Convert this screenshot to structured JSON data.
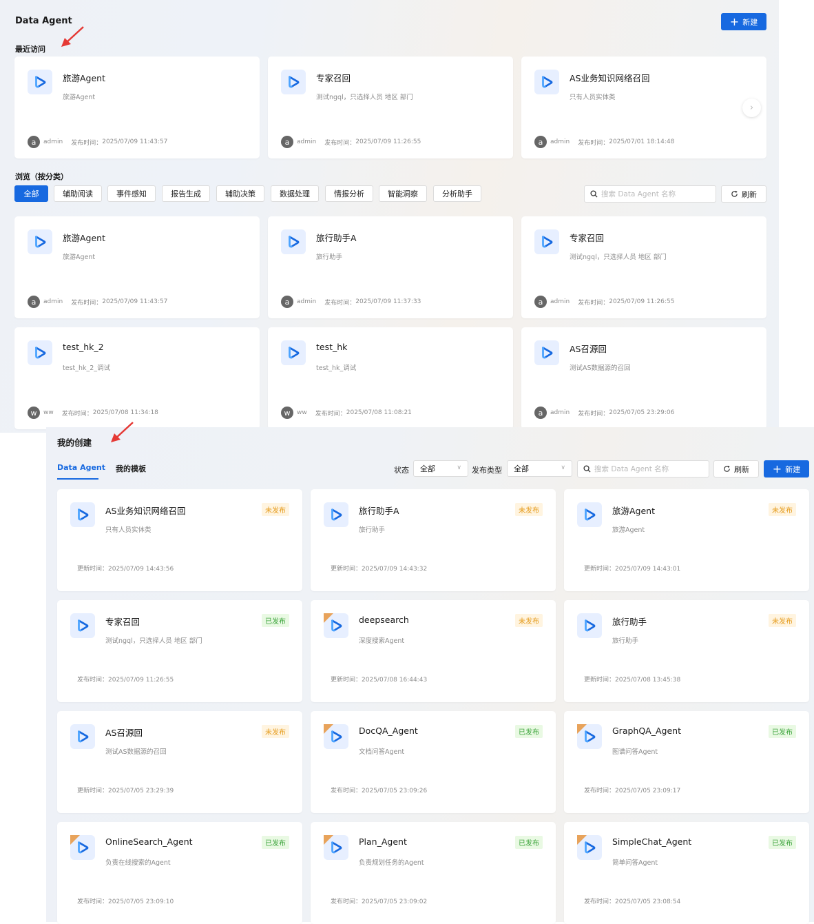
{
  "header": {
    "title": "Data Agent",
    "new_label": "新建"
  },
  "recent": {
    "title": "最近访问",
    "cards": [
      {
        "name": "旅游Agent",
        "desc": "旅游Agent",
        "avatar": "a",
        "author": "admin",
        "time_label": "发布时间：",
        "time": "2025/07/09 11:43:57"
      },
      {
        "name": "专家召回",
        "desc": "测试ngql，只选择人员 地区 部门",
        "avatar": "a",
        "author": "admin",
        "time_label": "发布时间：",
        "time": "2025/07/09 11:26:55"
      },
      {
        "name": "AS业务知识网络召回",
        "desc": "只有人员实体类",
        "avatar": "a",
        "author": "admin",
        "time_label": "发布时间：",
        "time": "2025/07/01 18:14:48"
      }
    ]
  },
  "browse": {
    "title": "浏览（按分类）",
    "categories": [
      "全部",
      "辅助阅读",
      "事件感知",
      "报告生成",
      "辅助决策",
      "数据处理",
      "情报分析",
      "智能洞察",
      "分析助手"
    ],
    "search_placeholder": "搜索 Data Agent 名称",
    "refresh_label": "刷新",
    "cards": [
      {
        "name": "旅游Agent",
        "desc": "旅游Agent",
        "avatar": "a",
        "author": "admin",
        "time_label": "发布时间：",
        "time": "2025/07/09 11:43:57"
      },
      {
        "name": "旅行助手A",
        "desc": "旅行助手",
        "avatar": "a",
        "author": "admin",
        "time_label": "发布时间：",
        "time": "2025/07/09 11:37:33"
      },
      {
        "name": "专家召回",
        "desc": "测试ngql，只选择人员 地区 部门",
        "avatar": "a",
        "author": "admin",
        "time_label": "发布时间：",
        "time": "2025/07/09 11:26:55"
      },
      {
        "name": "test_hk_2",
        "desc": "test_hk_2_调试",
        "avatar": "w",
        "author": "ww",
        "time_label": "发布时间：",
        "time": "2025/07/08 11:34:18"
      },
      {
        "name": "test_hk",
        "desc": "test_hk_调试",
        "avatar": "w",
        "author": "ww",
        "time_label": "发布时间：",
        "time": "2025/07/08 11:08:21"
      },
      {
        "name": "AS召源回",
        "desc": "测试AS数据源的召回",
        "avatar": "a",
        "author": "admin",
        "time_label": "发布时间：",
        "time": "2025/07/05 23:29:06"
      }
    ]
  },
  "mine": {
    "title": "我的创建",
    "tabs": [
      "Data Agent",
      "我的模板"
    ],
    "status_label": "状态",
    "status_value": "全部",
    "type_label": "发布类型",
    "type_value": "全部",
    "search_placeholder": "搜索 Data Agent 名称",
    "refresh_label": "刷新",
    "new_label": "新建",
    "cards": [
      {
        "name": "AS业务知识网络召回",
        "desc": "只有人员实体类",
        "status": "未发布",
        "time_label": "更新时间：",
        "time": "2025/07/09 14:43:56",
        "template": false
      },
      {
        "name": "旅行助手A",
        "desc": "旅行助手",
        "status": "未发布",
        "time_label": "更新时间：",
        "time": "2025/07/09 14:43:32",
        "template": false
      },
      {
        "name": "旅游Agent",
        "desc": "旅游Agent",
        "status": "未发布",
        "time_label": "更新时间：",
        "time": "2025/07/09 14:43:01",
        "template": false
      },
      {
        "name": "专家召回",
        "desc": "测试ngql，只选择人员 地区 部门",
        "status": "已发布",
        "time_label": "发布时间：",
        "time": "2025/07/09 11:26:55",
        "template": false
      },
      {
        "name": "deepsearch",
        "desc": "深度搜索Agent",
        "status": "未发布",
        "time_label": "更新时间：",
        "time": "2025/07/08 16:44:43",
        "template": true
      },
      {
        "name": "旅行助手",
        "desc": "旅行助手",
        "status": "未发布",
        "time_label": "更新时间：",
        "time": "2025/07/08 13:45:38",
        "template": false
      },
      {
        "name": "AS召源回",
        "desc": "测试AS数据源的召回",
        "status": "未发布",
        "time_label": "更新时间：",
        "time": "2025/07/05 23:29:39",
        "template": false
      },
      {
        "name": "DocQA_Agent",
        "desc": "文档问答Agent",
        "status": "已发布",
        "time_label": "发布时间：",
        "time": "2025/07/05 23:09:26",
        "template": true
      },
      {
        "name": "GraphQA_Agent",
        "desc": "图谱问答Agent",
        "status": "已发布",
        "time_label": "发布时间：",
        "time": "2025/07/05 23:09:17",
        "template": true
      },
      {
        "name": "OnlineSearch_Agent",
        "desc": "负责在线搜索的Agent",
        "status": "已发布",
        "time_label": "发布时间：",
        "time": "2025/07/05 23:09:10",
        "template": true
      },
      {
        "name": "Plan_Agent",
        "desc": "负责规划任务的Agent",
        "status": "已发布",
        "time_label": "发布时间：",
        "time": "2025/07/05 23:09:02",
        "template": true
      },
      {
        "name": "SimpleChat_Agent",
        "desc": "简单问答Agent",
        "status": "已发布",
        "time_label": "发布时间：",
        "time": "2025/07/05 23:08:54",
        "template": true
      }
    ]
  },
  "colors": {
    "primary": "#1769e0",
    "published": "#3aa33a",
    "unpublished": "#e59b1c",
    "annotation_arrow": "#e53935"
  }
}
